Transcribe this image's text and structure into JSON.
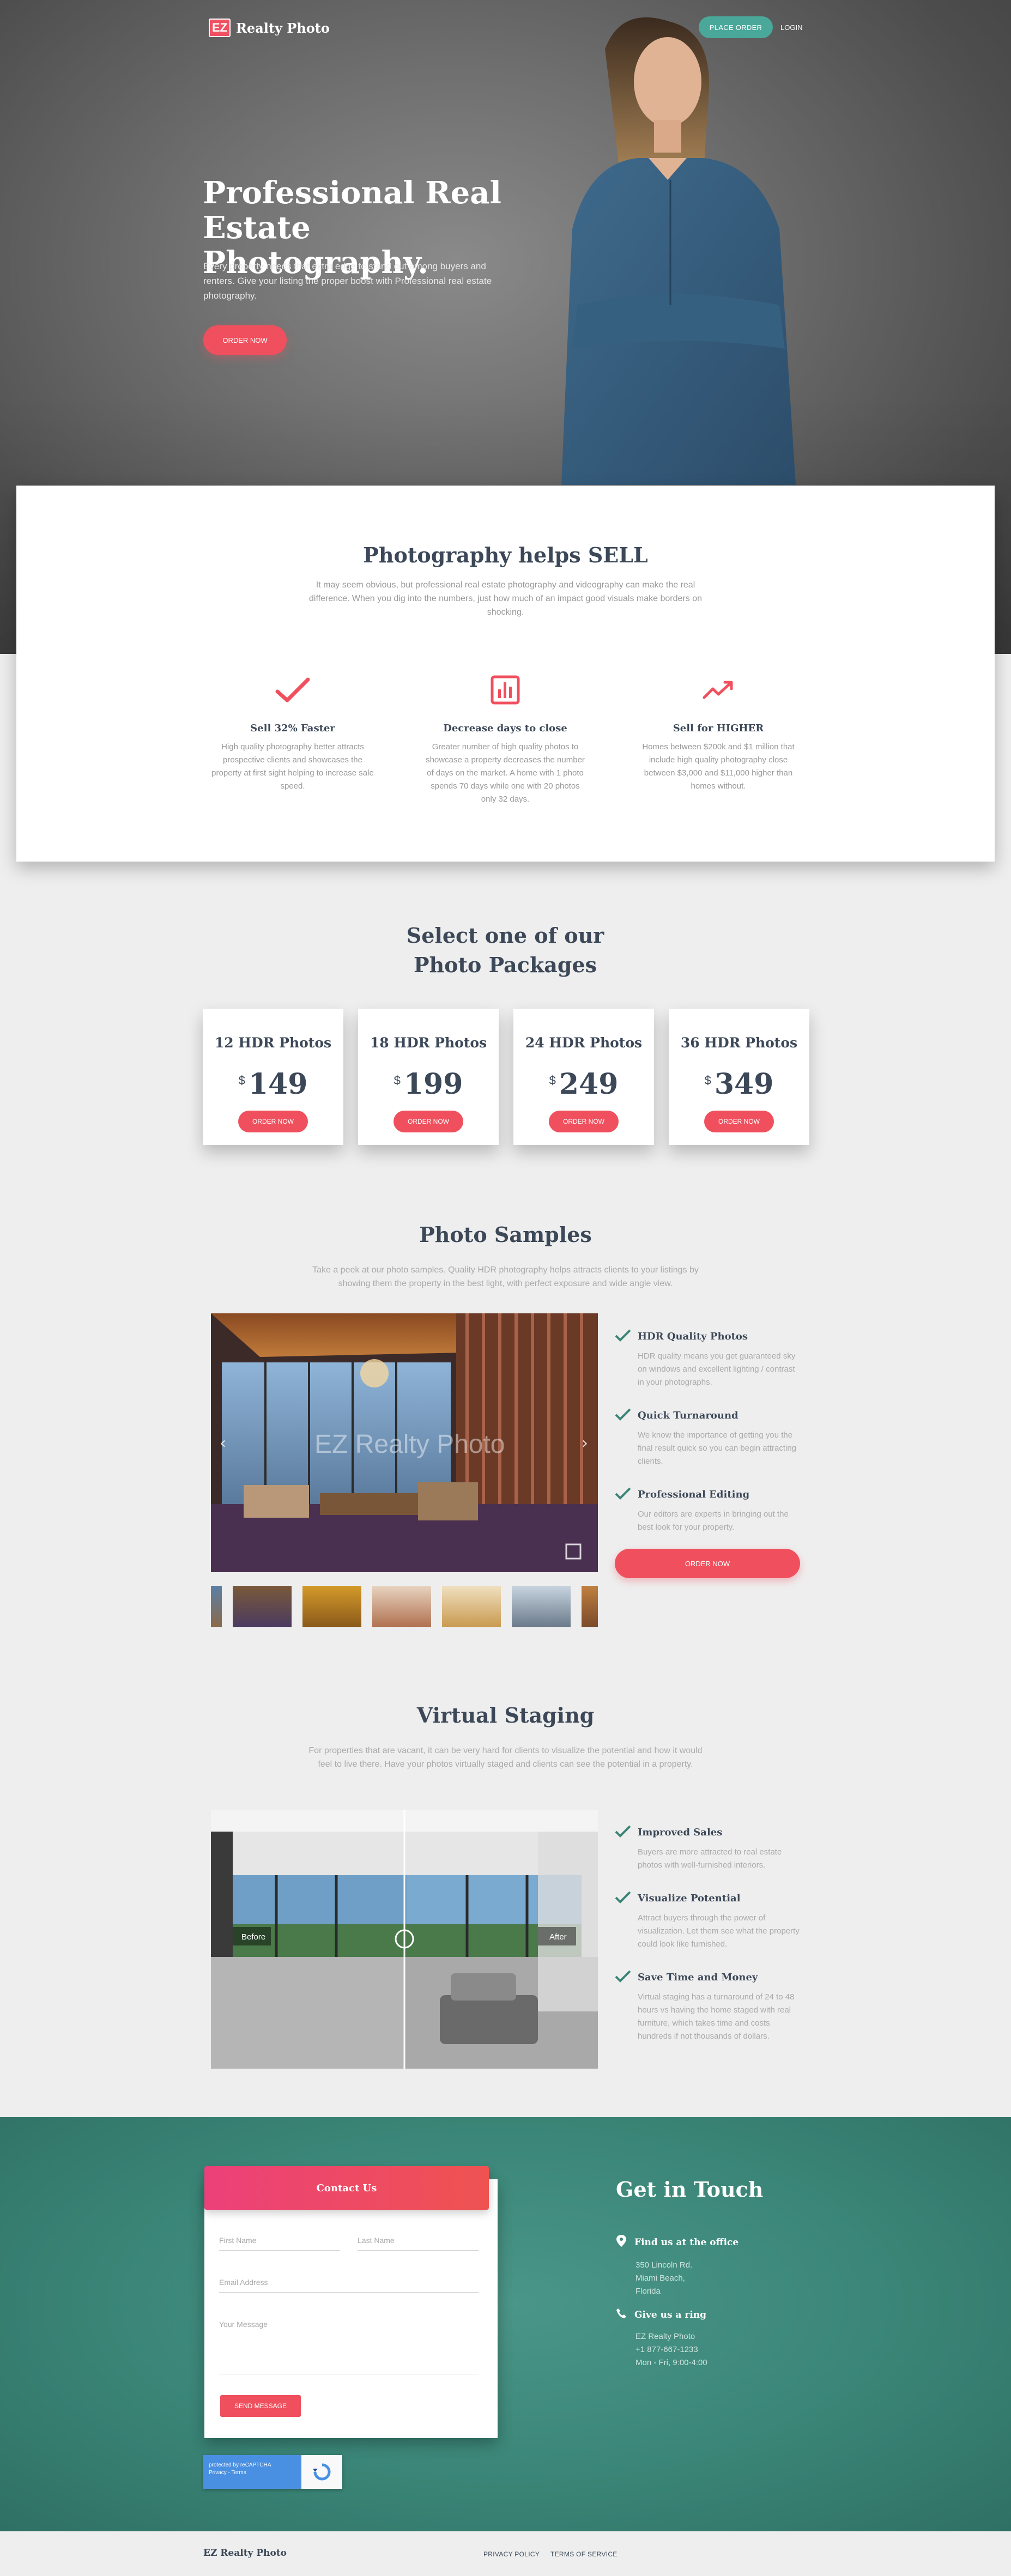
{
  "header": {
    "brand_logo": "EZ",
    "brand_name": "Realty Photo",
    "place_order": "PLACE ORDER",
    "login": "LOGIN"
  },
  "hero": {
    "title": "Professional Real Estate Photography.",
    "text": "Every property needs that extra edge to stand out among buyers and renters. Give your listing the proper boost with Professional real estate photography.",
    "button": "ORDER NOW"
  },
  "sell": {
    "title": "Photography helps SELL",
    "subtitle": "It may seem obvious, but professional real estate photography and videography can make the real difference. When you dig into the numbers, just how much of an impact good visuals make borders on shocking.",
    "features": [
      {
        "icon": "check-icon",
        "title": "Sell 32% Faster",
        "text": "High quality photography better attracts prospective clients and showcases the property at first sight helping to increase sale speed."
      },
      {
        "icon": "bar-chart-icon",
        "title": "Decrease days to close",
        "text": "Greater number of high quality photos to showcase a property decreases the number of days on the market. A home with 1 photo spends 70 days while one with 20 photos only 32 days."
      },
      {
        "icon": "trending-up-icon",
        "title": "Sell for HIGHER",
        "text": "Homes between $200k and $1 million that include high quality photography close between $3,000 and $11,000 higher than homes without."
      }
    ]
  },
  "packages": {
    "title": "Select one of our Photo Packages",
    "currency": "$",
    "button": "ORDER NOW",
    "items": [
      {
        "name": "12 HDR Photos",
        "price": "149"
      },
      {
        "name": "18 HDR Photos",
        "price": "199"
      },
      {
        "name": "24 HDR Photos",
        "price": "249"
      },
      {
        "name": "36 HDR Photos",
        "price": "349"
      }
    ]
  },
  "samples": {
    "title": "Photo Samples",
    "subtitle": "Take a peek at our photo samples. Quality HDR photography helps attracts clients to your listings by showing them the property in the best light, with perfect exposure and wide angle view.",
    "watermark": "EZ Realty Photo",
    "features": [
      {
        "title": "HDR Quality Photos",
        "text": "HDR quality means you get guaranteed sky on windows and excellent lighting / contrast in your photographs."
      },
      {
        "title": "Quick Turnaround",
        "text": "We know the importance of getting you the final result quick so you can begin attracting clients."
      },
      {
        "title": "Professional Editing",
        "text": "Our editors are experts in bringing out the best look for your property."
      }
    ],
    "button": "ORDER NOW"
  },
  "staging": {
    "title": "Virtual Staging",
    "subtitle": "For properties that are vacant, it can be very hard for clients to visualize the potential and how it would feel to live there. Have your photos virtually staged and clients can see the potential in a property.",
    "before": "Before",
    "after": "After",
    "features": [
      {
        "title": "Improved Sales",
        "text": "Buyers are more attracted to real estate photos with well-furnished interiors."
      },
      {
        "title": "Visualize Potential",
        "text": "Attract buyers through the power of visualization. Let them see what the property could look like furnished."
      },
      {
        "title": "Save Time and Money",
        "text": "Virtual staging has a turnaround of 24 to 48 hours vs having the home staged with real furniture, which takes time and costs hundreds if not thousands of dollars."
      }
    ]
  },
  "contact": {
    "form_title": "Contact Us",
    "first_name": "First Name",
    "last_name": "Last Name",
    "email": "Email Address",
    "message": "Your Message",
    "send": "SEND MESSAGE",
    "recaptcha_line1": "protected by reCAPTCHA",
    "recaptcha_line2": "Privacy - Terms",
    "heading": "Get in Touch",
    "office_title": "Find us at the office",
    "office_lines": [
      "350 Lincoln Rd.",
      "Miami Beach,",
      "Florida"
    ],
    "ring_title": "Give us a ring",
    "ring_lines": [
      "EZ Realty Photo",
      "+1 877-667-1233",
      "Mon - Fri, 9:00-4:00"
    ]
  },
  "footer": {
    "brand": "EZ Realty Photo",
    "privacy": "PRIVACY POLICY",
    "terms": "TERMS OF SERVICE"
  },
  "colors": {
    "accent": "#f0505e",
    "teal": "#3a8577",
    "dark_text": "#3c4858"
  }
}
